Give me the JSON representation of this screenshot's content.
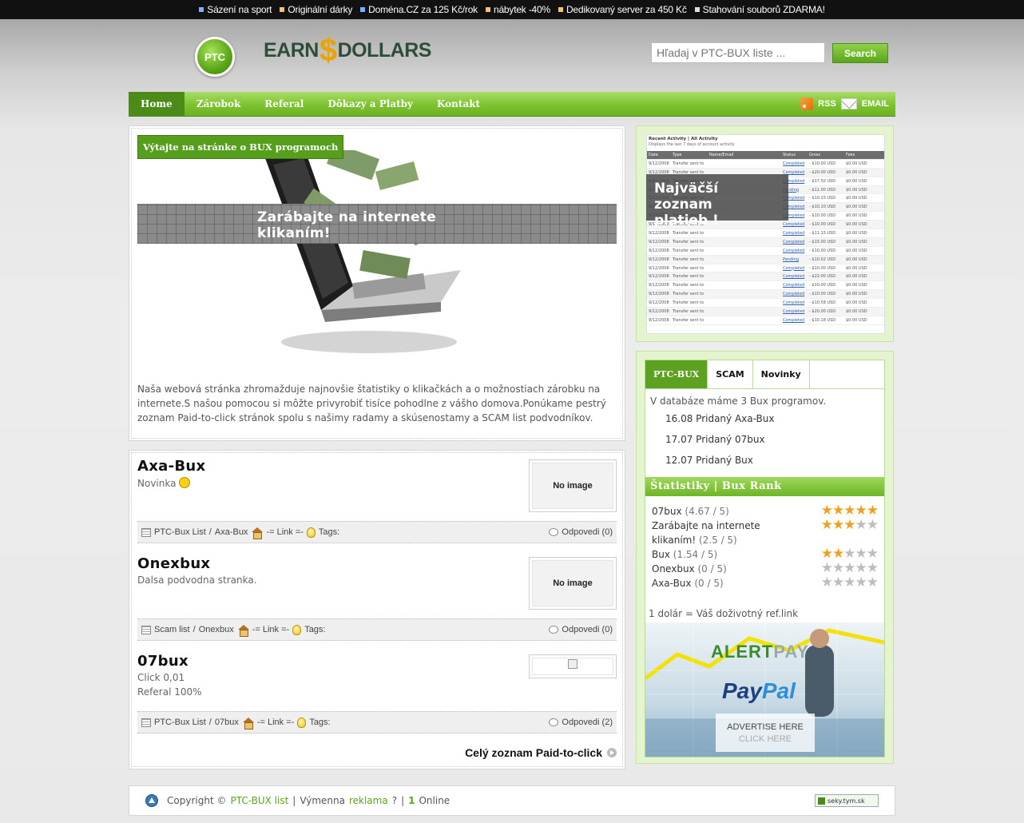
{
  "topbar": {
    "links": [
      {
        "label": "Sázení na sport",
        "color": "#7fb0ff"
      },
      {
        "label": "Originální dárky",
        "color": "#f2c27a"
      },
      {
        "label": "Doména.CZ za 125 Kč/rok",
        "color": "#7fb0ff"
      },
      {
        "label": "nábytek -40%",
        "color": "#f2c27a"
      },
      {
        "label": "Dedikovaný server za 450 Kč",
        "color": "#f2c27a"
      },
      {
        "label": "Stahování souborů ZDARMA!",
        "color": "#dddddd"
      }
    ]
  },
  "header": {
    "logo_badge": "PTC",
    "logo_left": "EARN",
    "logo_symbol": "$",
    "logo_right": "DOLLARS",
    "search_placeholder": "Hľadaj v PTC-BUX liste ...",
    "search_button": "Search"
  },
  "nav": {
    "items": [
      "Home",
      "Zárobok",
      "Referal",
      "Dôkazy a Platby",
      "Kontakt"
    ],
    "rss": "RSS",
    "email": "EMAIL"
  },
  "welcome": {
    "tag": "Výtajte na stránke o BUX programoch",
    "hero_line1": "Zarábajte na internete",
    "hero_line2": "klikaním!",
    "description": "Naša webová stránka zhromažduje najnovšie štatistiky o klikačkách a o možnostiach zárobku na internete.S našou pomocou si môžte privyrobiť tisíce pohodlne z vášho domova.Ponúkame pestrý zoznam Paid-to-click stránok spolu s našimy radamy a skúsenostamy a SCAM list podvodníkov."
  },
  "posts": [
    {
      "title": "Axa-Bux",
      "lines": [
        "Novinka"
      ],
      "image": "No image",
      "category": "PTC-Bux List",
      "name": "Axa-Bux",
      "link": "-= Link =-",
      "tags": "Tags:",
      "replies": "Odpovedi (0)"
    },
    {
      "title": "Onexbux",
      "lines": [
        "Dalsa podvodna stranka."
      ],
      "image": "No image",
      "category": "Scam list",
      "name": "Onexbux",
      "link": "-= Link =-",
      "tags": "Tags:",
      "replies": "Odpovedi (0)"
    },
    {
      "title": "07bux",
      "lines": [
        "Click 0,01",
        "Referal 100%"
      ],
      "image": "",
      "category": "PTC-Bux List",
      "name": "07bux",
      "link": "-= Link =-",
      "tags": "Tags:",
      "replies": "Odpovedi (2)"
    }
  ],
  "more_link": "Celý zoznam Paid-to-click",
  "payouts": {
    "overlay_line1": "Najväčší zoznam",
    "overlay_line2": "platieb !",
    "caption": "Recent Activity | All Activity",
    "caption2": "Displays the last 7 days of account activity",
    "columns": [
      "Date",
      "Type",
      "Name/Email",
      "Status",
      "Gross",
      "Fees"
    ],
    "rows": [
      [
        "9/12/2008",
        "Transfer sent to",
        "",
        "Completed",
        "- $10.00 USD",
        "$0.00 USD"
      ],
      [
        "9/12/2008",
        "Transfer sent to",
        "",
        "Completed",
        "- $20.00 USD",
        "$0.00 USD"
      ],
      [
        "9/12/2008",
        "Transfer sent to",
        "",
        "Completed",
        "- $17.50 USD",
        "$0.00 USD"
      ],
      [
        "9/12/2008",
        "Transfer sent to",
        "",
        "Pending",
        "- $11.00 USD",
        "$0.00 USD"
      ],
      [
        "9/12/2008",
        "Transfer sent to",
        "",
        "Completed",
        "- $10.15 USD",
        "$0.00 USD"
      ],
      [
        "9/12/2008",
        "Transfer sent to",
        "",
        "Completed",
        "- $10.10 USD",
        "$0.00 USD"
      ],
      [
        "9/12/2008",
        "Transfer sent to",
        "",
        "Completed",
        "- $10.00 USD",
        "$0.00 USD"
      ],
      [
        "9/12/2008",
        "Transfer sent to",
        "",
        "Completed",
        "- $10.00 USD",
        "$0.00 USD"
      ],
      [
        "9/12/2008",
        "Transfer sent to",
        "",
        "Completed",
        "- $11.15 USD",
        "$0.00 USD"
      ],
      [
        "9/12/2008",
        "Transfer sent to",
        "",
        "Completed",
        "- $15.00 USD",
        "$0.00 USD"
      ],
      [
        "9/12/2008",
        "Transfer sent to",
        "",
        "Completed",
        "- $10.00 USD",
        "$0.00 USD"
      ],
      [
        "9/12/2008",
        "Transfer sent to",
        "",
        "Pending",
        "- $10.02 USD",
        "$0.00 USD"
      ],
      [
        "9/12/2008",
        "Transfer sent to",
        "",
        "Completed",
        "- $10.00 USD",
        "$0.00 USD"
      ],
      [
        "9/12/2008",
        "Transfer sent to",
        "",
        "Completed",
        "- $22.00 USD",
        "$0.00 USD"
      ],
      [
        "9/12/2008",
        "Transfer sent to",
        "",
        "Completed",
        "- $10.00 USD",
        "$0.00 USD"
      ],
      [
        "9/12/2008",
        "Transfer sent to",
        "",
        "Completed",
        "- $10.00 USD",
        "$0.00 USD"
      ],
      [
        "9/12/2008",
        "Transfer sent to",
        "",
        "Completed",
        "- $10.58 USD",
        "$0.00 USD"
      ],
      [
        "9/12/2008",
        "Transfer sent to",
        "",
        "Completed",
        "- $20.00 USD",
        "$0.00 USD"
      ],
      [
        "9/12/2008",
        "Transfer sent to",
        "",
        "Completed",
        "- $10.18 USD",
        "$0.00 USD"
      ]
    ]
  },
  "tabs": {
    "items": [
      "PTC-BUX",
      "SCAM",
      "Novinky"
    ],
    "db_text": "V databáze máme 3 Bux programov.",
    "news": [
      "16.08 Pridaný Axa-Bux",
      "17.07 Pridaný 07bux",
      "12.07 Pridaný Bux"
    ]
  },
  "stats": {
    "header": "Štatistiky | Bux Rank",
    "rows": [
      {
        "name": "07bux",
        "score": "(4.67 / 5)",
        "rating": 4.67
      },
      {
        "name": "Zarábajte na internete klikaním!",
        "score": "(2.5 / 5)",
        "rating": 2.5
      },
      {
        "name": "Bux",
        "score": "(1.54 / 5)",
        "rating": 1.54
      },
      {
        "name": "Onexbux",
        "score": "(0 / 5)",
        "rating": 0
      },
      {
        "name": "Axa-Bux",
        "score": "(0 / 5)",
        "rating": 0
      }
    ],
    "dollar_text": "1 dolár = Váš doživotný ref.link"
  },
  "ad": {
    "alertpay_a": "ALERT",
    "alertpay_b": "PAY",
    "paypal_a": "Pay",
    "paypal_b": "Pal",
    "line1": "ADVERTISE HERE",
    "line2": "CLICK HERE"
  },
  "footer": {
    "copyright": "Copyright ©",
    "site": "PTC-BUX list",
    "sep1": "|",
    "exchange": "Výmenna",
    "ad": "reklama",
    "q": "?",
    "sep2": "|",
    "online_count": "1",
    "online": "Online",
    "badge": "seky.tym.sk"
  },
  "colors": {
    "accent": "#6db526",
    "nav_active": "#4d8b18",
    "star_on": "#f0a020",
    "star_off": "#bdbdbd"
  }
}
